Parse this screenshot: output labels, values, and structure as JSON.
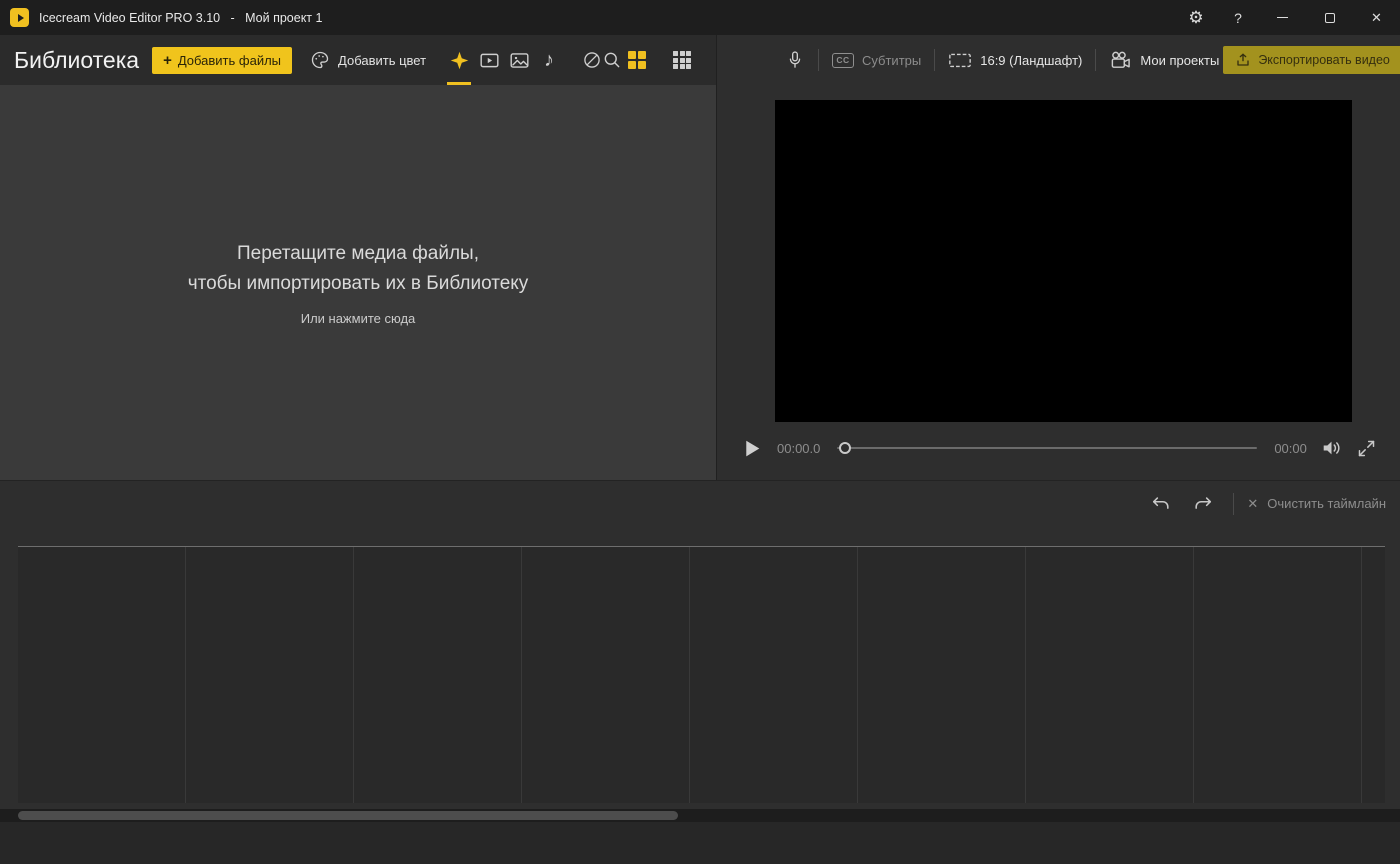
{
  "colors": {
    "accent": "#f0c020",
    "export_button": "#a3921e",
    "panel_dark": "#2b2b2b",
    "library_bg": "#3a3a3a"
  },
  "icons": {
    "gear": "⚙",
    "help": "?",
    "close": "✕",
    "plus": "+",
    "music_note": "♪",
    "cc": "CC",
    "clear_x": "✕"
  },
  "titlebar": {
    "title": "Icecream Video Editor PRO 3.10   -   Мой проект 1"
  },
  "library": {
    "title": "Библиотека",
    "add_files_label": "Добавить файлы",
    "add_color_label": "Добавить цвет",
    "drop_line1": "Перетащите медиа файлы,",
    "drop_line2": "чтобы импортировать их в Библиотеку",
    "drop_hint": "Или нажмите сюда"
  },
  "preview": {
    "subtitles_label": "Субтитры",
    "aspect_label": "16:9 (Ландшафт)",
    "projects_label": "Мои проекты",
    "export_label": "Экспортировать видео",
    "current_time": "00:00.0",
    "total_time": "00:00"
  },
  "timeline": {
    "clear_label": "Очистить таймлайн"
  }
}
